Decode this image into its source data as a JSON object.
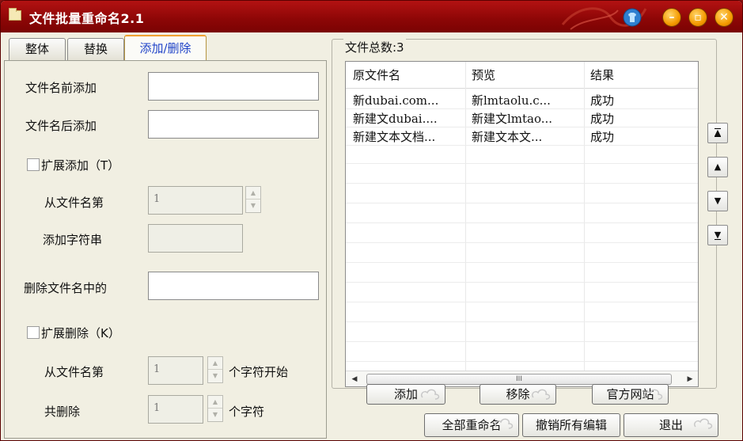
{
  "window": {
    "title": "文件批量重命名2.1"
  },
  "tabs": [
    {
      "label": "整体"
    },
    {
      "label": "替换"
    },
    {
      "label": "添加/删除",
      "active": true
    }
  ],
  "add_remove": {
    "prefix_label": "文件名前添加",
    "prefix_value": "",
    "suffix_label": "文件名后添加",
    "suffix_value": "",
    "ext_add_label": "扩展添加（T）",
    "ext_add_checked": false,
    "from_pos_label": "从文件名第",
    "from_pos_value": "1",
    "add_string_label": "添加字符串",
    "add_string_value": "",
    "delete_label": "删除文件名中的",
    "delete_value": "",
    "ext_delete_label": "扩展删除（K）",
    "ext_delete_checked": false,
    "del_from_label": "从文件名第",
    "del_from_value": "1",
    "del_from_suffix": "个字符开始",
    "del_count_label": "共删除",
    "del_count_value": "1",
    "del_count_suffix": "个字符"
  },
  "file_list": {
    "count_label": "文件总数:3",
    "columns": [
      "原文件名",
      "预览",
      "结果"
    ],
    "rows": [
      {
        "original": "新dubai.com...",
        "preview": "新lmtaolu.c...",
        "result": "成功"
      },
      {
        "original": "新建文dubai....",
        "preview": "新建文lmtao...",
        "result": "成功"
      },
      {
        "original": "新建文本文档...",
        "preview": "新建文本文...",
        "result": "成功"
      }
    ],
    "scroll_thumb": "III"
  },
  "nav_buttons": {
    "top": "▲̲",
    "up": "▲",
    "down": "▼",
    "bottom": "▼"
  },
  "buttons": {
    "add": "添加",
    "remove": "移除",
    "website": "官方网站",
    "rename_all": "全部重命名",
    "undo_all": "撤销所有编辑",
    "exit": "退出"
  },
  "colors": {
    "titlebar": "#a50d0d",
    "active_tab_text": "#1f43c8",
    "window_bg": "#f1efe2"
  }
}
